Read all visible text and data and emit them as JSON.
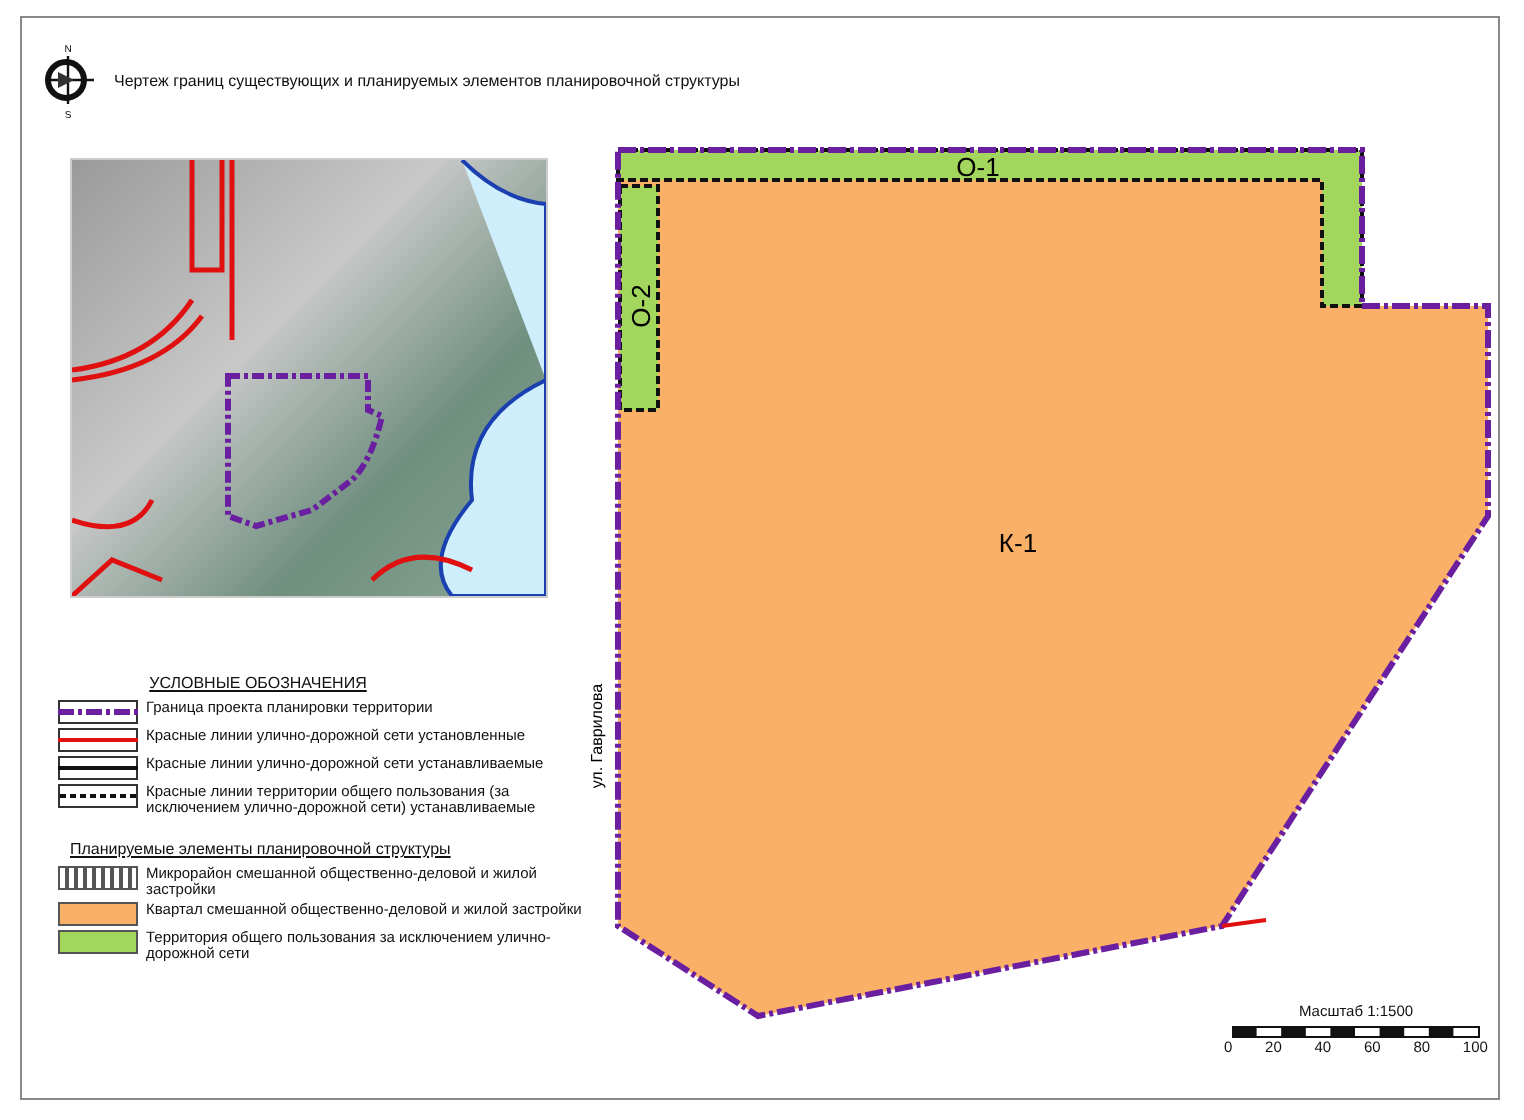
{
  "compass": {
    "north": "N",
    "south": "S"
  },
  "title": "Чертеж границ существующих и планируемых элементов планировочной структуры",
  "legend": {
    "heading": "УСЛОВНЫЕ ОБОЗНАЧЕНИЯ",
    "lines": [
      {
        "kind": "boundary",
        "label": "Граница проекта планировки территории"
      },
      {
        "kind": "red",
        "label": "Красные линии улично-дорожной сети установленные"
      },
      {
        "kind": "black",
        "label": "Красные линии улично-дорожной сети устанавливаемые"
      },
      {
        "kind": "dashed",
        "label": "Красные линии территории общего пользования (за исключением улично-дорожной сети) устанавливаемые"
      }
    ],
    "subheading": "Планируемые элементы планировочной структуры",
    "elements": [
      {
        "kind": "hatched",
        "label": "Микрорайон смешанной общественно-деловой и жилой застройки"
      },
      {
        "kind": "orange",
        "label": "Квартал смешанной общественно-деловой и жилой застройки"
      },
      {
        "kind": "green",
        "label": "Территория общего пользования за исключением улично-дорожной сети"
      }
    ]
  },
  "map": {
    "zones": [
      {
        "kind": "quarter",
        "label": "К-1"
      },
      {
        "kind": "public_top",
        "label": "О-1"
      },
      {
        "kind": "public_left",
        "label": "О-2"
      }
    ],
    "street": "ул. Гаврилова"
  },
  "scale": {
    "label": "Масштаб 1:1500",
    "ticks": [
      "0",
      "20",
      "40",
      "60",
      "80",
      "100"
    ]
  }
}
